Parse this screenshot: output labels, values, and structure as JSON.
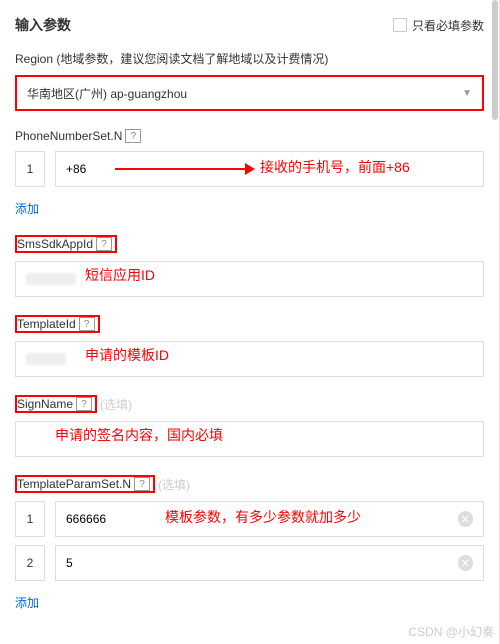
{
  "header": {
    "title": "输入参数",
    "show_required_only": "只看必填参数"
  },
  "region": {
    "label": "Region (地域参数，建议您阅读文档了解地域以及计费情况)",
    "value": "华南地区(广州) ap-guangzhou"
  },
  "phone": {
    "label": "PhoneNumberSet.N",
    "rows": [
      {
        "index": "1",
        "value": "+86"
      }
    ],
    "add": "添加",
    "annotation": "接收的手机号，前面+86"
  },
  "appid": {
    "label": "SmsSdkAppId",
    "value": "",
    "annotation": "短信应用ID"
  },
  "template": {
    "label": "TemplateId",
    "value": "",
    "annotation": "申请的模板ID"
  },
  "sign": {
    "label": "SignName",
    "optional": "(选填)",
    "value": "",
    "annotation": "申请的签名内容，国内必填"
  },
  "params": {
    "label": "TemplateParamSet.N",
    "optional": "(选填)",
    "rows": [
      {
        "index": "1",
        "value": "666666"
      },
      {
        "index": "2",
        "value": "5"
      }
    ],
    "add": "添加",
    "annotation": "模板参数，有多少参数就加多少"
  },
  "watermark": "CSDN @小幻奏",
  "help_icon": "?"
}
